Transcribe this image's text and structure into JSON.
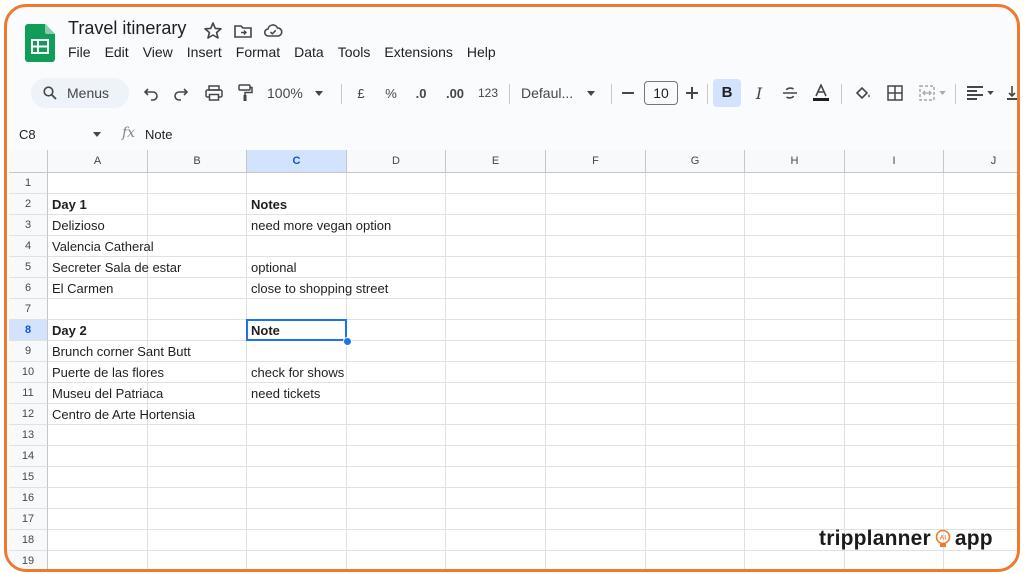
{
  "document": {
    "title": "Travel itinerary"
  },
  "menubar": [
    "File",
    "Edit",
    "View",
    "Insert",
    "Format",
    "Data",
    "Tools",
    "Extensions",
    "Help"
  ],
  "toolbar": {
    "search_label": "Menus",
    "zoom": "100%",
    "currency": "£",
    "percent": "%",
    "dec_decrease": ".0",
    "dec_increase": ".00",
    "number_format": "123",
    "font": "Defaul...",
    "font_size": "10",
    "bold": "B",
    "italic": "I"
  },
  "formula_bar": {
    "cell_ref": "C8",
    "fx": "fx",
    "content": "Note"
  },
  "columns": [
    "A",
    "B",
    "C",
    "D",
    "E",
    "F",
    "G",
    "H",
    "I",
    "J"
  ],
  "rows": [
    "1",
    "2",
    "3",
    "4",
    "5",
    "6",
    "7",
    "8",
    "9",
    "10",
    "11",
    "12",
    "13",
    "14",
    "15",
    "16",
    "17",
    "18",
    "19"
  ],
  "cells": {
    "A2": "Day 1",
    "C2": "Notes",
    "A3": "Delizioso",
    "C3": "need more vegan option",
    "A4": "Valencia Catheral",
    "A5": "Secreter Sala de estar",
    "C5": "optional",
    "A6": "El Carmen",
    "C6": "close to shopping street",
    "A8": "Day 2",
    "C8": "Note",
    "A9": "Brunch corner Sant Butt",
    "A10": "Puerte de las flores",
    "C10": "check for shows",
    "A11": "Museu del Patriaca",
    "C11": "need tickets",
    "A12": "Centro de Arte Hortensia"
  },
  "selection": {
    "column": "C",
    "row": "8"
  },
  "watermark": {
    "left": "tripplanner",
    "ai": "AI",
    "right": "app"
  },
  "colors": {
    "accent": "#1a73e8",
    "frame": "#ee7a2e",
    "sheets_green": "#0f9d58"
  }
}
